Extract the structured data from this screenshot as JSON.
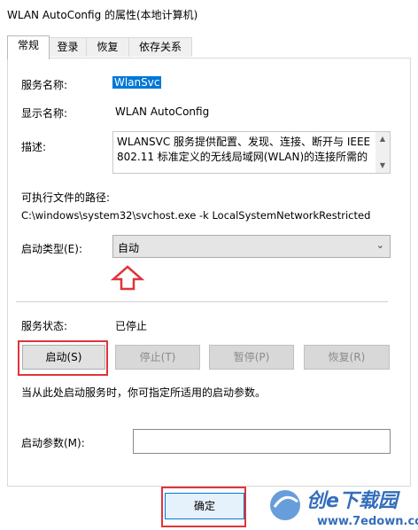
{
  "window": {
    "title": "WLAN AutoConfig 的属性(本地计算机)"
  },
  "tabs": [
    {
      "label": "常规"
    },
    {
      "label": "登录"
    },
    {
      "label": "恢复"
    },
    {
      "label": "依存关系"
    }
  ],
  "general": {
    "service_name_label": "服务名称:",
    "service_name_value": "WlanSvc",
    "display_name_label": "显示名称:",
    "display_name_value": "WLAN AutoConfig",
    "description_label": "描述:",
    "description_value": "WLANSVC 服务提供配置、发现、连接、断开与 IEEE 802.11 标准定义的无线局域网(WLAN)的连接所需的",
    "exec_path_label": "可执行文件的路径:",
    "exec_path_value": "C:\\windows\\system32\\svchost.exe -k LocalSystemNetworkRestricted",
    "startup_type_label": "启动类型(E):",
    "startup_type_value": "自动",
    "service_status_label": "服务状态:",
    "service_status_value": "已停止",
    "buttons": {
      "start": "启动(S)",
      "stop": "停止(T)",
      "pause": "暂停(P)",
      "resume": "恢复(R)"
    },
    "hint": "当从此处启动服务时，你可指定所适用的启动参数。",
    "start_params_label": "启动参数(M):",
    "start_params_value": ""
  },
  "footer": {
    "ok_label": "确定"
  },
  "watermark": {
    "text1": "创e下载园",
    "text2": "www.7edown.com"
  },
  "colors": {
    "highlight_box": "#e0343b",
    "selection": "#0078d7"
  }
}
